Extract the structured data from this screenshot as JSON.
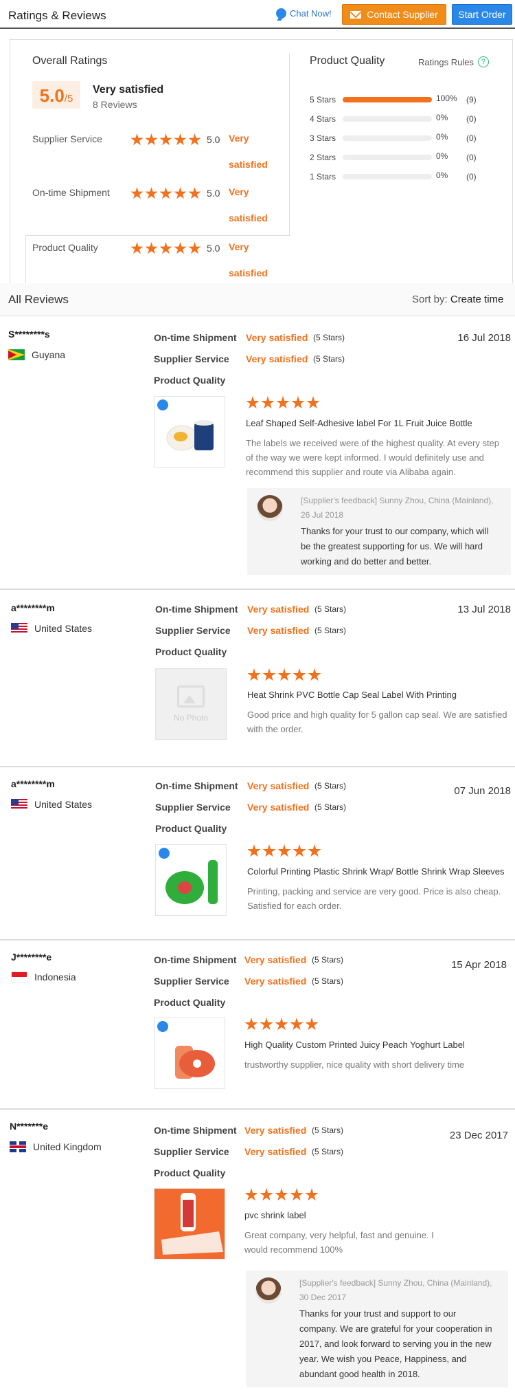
{
  "header": {
    "title": "Ratings & Reviews",
    "chat_label": "Chat Now!",
    "contact_label": "Contact Supplier",
    "order_label": "Start Order"
  },
  "overall": {
    "title": "Overall Ratings",
    "score": "5.0",
    "score_max": "/5",
    "label": "Very satisfied",
    "count": "8 Reviews",
    "categories": [
      {
        "name": "Supplier Service",
        "score": "5.0",
        "label": "Very satisfied",
        "stars": 5
      },
      {
        "name": "On-time Shipment",
        "score": "5.0",
        "label": "Very satisfied",
        "stars": 5
      },
      {
        "name": "Product Quality",
        "score": "5.0",
        "label": "Very satisfied",
        "stars": 5
      }
    ]
  },
  "quality": {
    "title": "Product Quality",
    "rules_label": "Ratings Rules",
    "rules_icon": "help-icon",
    "distribution": [
      {
        "label": "5 Stars",
        "fraction": 1.0,
        "pct": "100%",
        "count": "(9)"
      },
      {
        "label": "4 Stars",
        "fraction": 0,
        "pct": "0%",
        "count": "(0)"
      },
      {
        "label": "3 Stars",
        "fraction": 0,
        "pct": "0%",
        "count": "(0)"
      },
      {
        "label": "2 Stars",
        "fraction": 0,
        "pct": "0%",
        "count": "(0)"
      },
      {
        "label": "1 Stars",
        "fraction": 0,
        "pct": "0%",
        "count": "(0)"
      }
    ]
  },
  "reviews_header": {
    "title": "All Reviews",
    "sort_prefix": "Sort by:",
    "sort_value": "Create time"
  },
  "labels": {
    "shipment": "On-time Shipment",
    "service": "Supplier Service",
    "quality": "Product Quality",
    "satisfied": "Very satisfied",
    "five_stars": "(5 Stars)",
    "no_photo": "No Photo"
  },
  "reviews": [
    {
      "user": "S********s",
      "country": "Guyana",
      "date": "16 Jul 2018",
      "product": "Leaf Shaped Self-Adhesive label For 1L Fruit Juice Bottle",
      "text": "The labels we received were of the highest quality. At every step of the way we were kept informed. I would definitely use and recommend this supplier and route via Alibaba again.",
      "feedback_header": "[Supplier's feedback] Sunny Zhou, China (Mainland), 26 Jul 2018",
      "feedback_text": "Thanks for your trust to our company, which will be the greatest supporting for us. We will hard working and do better and better."
    },
    {
      "user": "a********m",
      "country": "United States",
      "date": "13 Jul 2018",
      "product": "Heat Shrink PVC Bottle Cap Seal Label With Printing",
      "text": "Good price and high quality for 5 gallon cap seal. We are satisfied with the order."
    },
    {
      "user": "a********m",
      "country": "United States",
      "date": "07 Jun 2018",
      "product": "Colorful Printing Plastic Shrink Wrap/ Bottle Shrink Wrap Sleeves",
      "text": "Printing, packing and service are very good. Price is also cheap. Satisfied for each order."
    },
    {
      "user": "J********e",
      "country": "Indonesia",
      "date": "15 Apr 2018",
      "product": "High Quality Custom Printed Juicy Peach Yoghurt Label",
      "text": "trustworthy supplier, nice quality with short delivery time"
    },
    {
      "user": "N*******e",
      "country": "United Kingdom",
      "date": "23 Dec 2017",
      "product": "pvc shrink label",
      "text": "Great company, very helpful, fast and genuine. I would recommend 100%",
      "feedback_header": "[Supplier's feedback] Sunny Zhou, China (Mainland), 30 Dec 2017",
      "feedback_text": "Thanks for your trust and support to our company. We are grateful for your cooperation in 2017, and look forward to serving you in the new year. We wish you Peace, Happiness, and abundant good health in 2018."
    }
  ]
}
